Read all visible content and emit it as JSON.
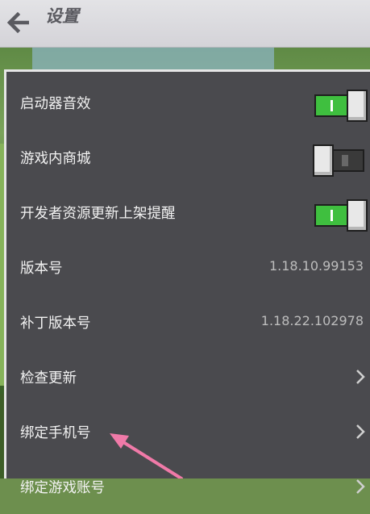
{
  "header": {
    "title": "设置"
  },
  "settings": [
    {
      "label": "启动器音效",
      "type": "toggle",
      "on": true
    },
    {
      "label": "游戏内商城",
      "type": "toggle",
      "on": false
    },
    {
      "label": "开发者资源更新上架提醒",
      "type": "toggle",
      "on": true
    },
    {
      "label": "版本号",
      "type": "value",
      "value": "1.18.10.99153"
    },
    {
      "label": "补丁版本号",
      "type": "value",
      "value": "1.18.22.102978"
    },
    {
      "label": "检查更新",
      "type": "nav"
    },
    {
      "label": "绑定手机号",
      "type": "nav"
    },
    {
      "label": "绑定游戏账号",
      "type": "nav"
    }
  ],
  "colors": {
    "toggle_on": "#3fbf3f",
    "annotation_arrow": "#f07aa8"
  }
}
